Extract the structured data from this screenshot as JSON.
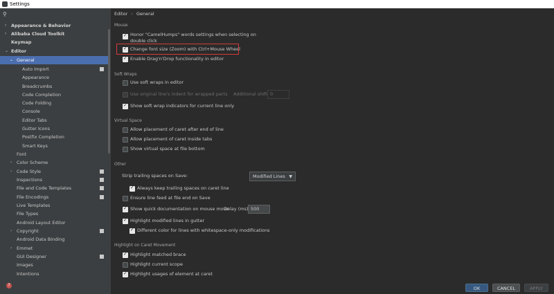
{
  "window": {
    "title": "Settings"
  },
  "search": {
    "icon": "search-icon"
  },
  "sidebar": {
    "items": [
      {
        "label": "Appearance & Behavior",
        "arrow": "›"
      },
      {
        "label": "Alibaba Cloud Toolkit",
        "arrow": "›"
      },
      {
        "label": "Keymap",
        "arrow": ""
      },
      {
        "label": "Editor",
        "arrow": "⌄"
      },
      {
        "label": "General",
        "arrow": "⌄"
      },
      {
        "label": "Auto Import"
      },
      {
        "label": "Appearance"
      },
      {
        "label": "Breadcrumbs"
      },
      {
        "label": "Code Completion"
      },
      {
        "label": "Code Folding"
      },
      {
        "label": "Console"
      },
      {
        "label": "Editor Tabs"
      },
      {
        "label": "Gutter Icons"
      },
      {
        "label": "Postfix Completion"
      },
      {
        "label": "Smart Keys"
      },
      {
        "label": "Font"
      },
      {
        "label": "Color Scheme",
        "arrow": "›"
      },
      {
        "label": "Code Style",
        "arrow": "›"
      },
      {
        "label": "Inspections"
      },
      {
        "label": "File and Code Templates"
      },
      {
        "label": "File Encodings"
      },
      {
        "label": "Live Templates"
      },
      {
        "label": "File Types"
      },
      {
        "label": "Android Layout Editor"
      },
      {
        "label": "Copyright",
        "arrow": "›"
      },
      {
        "label": "Android Data Binding"
      },
      {
        "label": "Emmet",
        "arrow": "›"
      },
      {
        "label": "GUI Designer"
      },
      {
        "label": "Images"
      },
      {
        "label": "Intentions"
      }
    ]
  },
  "breadcrumb": {
    "editor": "Editor",
    "sep": "›",
    "general": "General"
  },
  "sections": {
    "mouse": "Mouse",
    "soft_wraps": "Soft Wraps",
    "virtual_space": "Virtual Space",
    "other": "Other",
    "highlight_caret": "Highlight on Caret Movement"
  },
  "mouse": {
    "camel_1": "Honor \"CamelHumps\" words settings when selecting on",
    "camel_2": "double click",
    "zoom": "Change font size (Zoom) with Ctrl+Mouse Wheel",
    "dnd": "Enable Drag'n'Drop functionality in editor"
  },
  "soft_wraps": {
    "use_soft": "Use soft wraps in editor",
    "use_indent": "Use original line's indent for wrapped parts",
    "additional_shift_label": "Additional shift:",
    "additional_shift_value": "0",
    "show_indicators": "Show soft wrap indicators for current line only"
  },
  "virtual_space": {
    "after_end": "Allow placement of caret after end of line",
    "inside_tabs": "Allow placement of caret inside tabs",
    "show_virtual": "Show virtual space at file bottom"
  },
  "other": {
    "strip_label": "Strip trailing spaces on Save:",
    "strip_value": "Modified Lines",
    "always_keep": "Always keep trailing spaces on caret line",
    "ensure_lf": "Ensure line feed at file end on Save",
    "quick_doc": "Show quick documentation on mouse move",
    "delay_label": "Delay (ms):",
    "delay_value": "500",
    "highlight_modified": "Highlight modified lines in gutter",
    "diff_color": "Different color for lines with whitespace-only modifications"
  },
  "highlight_caret": {
    "matched_brace": "Highlight matched brace",
    "current_scope": "Highlight current scope",
    "usages": "Highlight usages of element at caret"
  },
  "footer": {
    "ok": "OK",
    "cancel": "CANCEL",
    "apply": "APPLY"
  },
  "colors": {
    "accent": "#4b6eaf",
    "highlight_border": "#d53a3a"
  }
}
